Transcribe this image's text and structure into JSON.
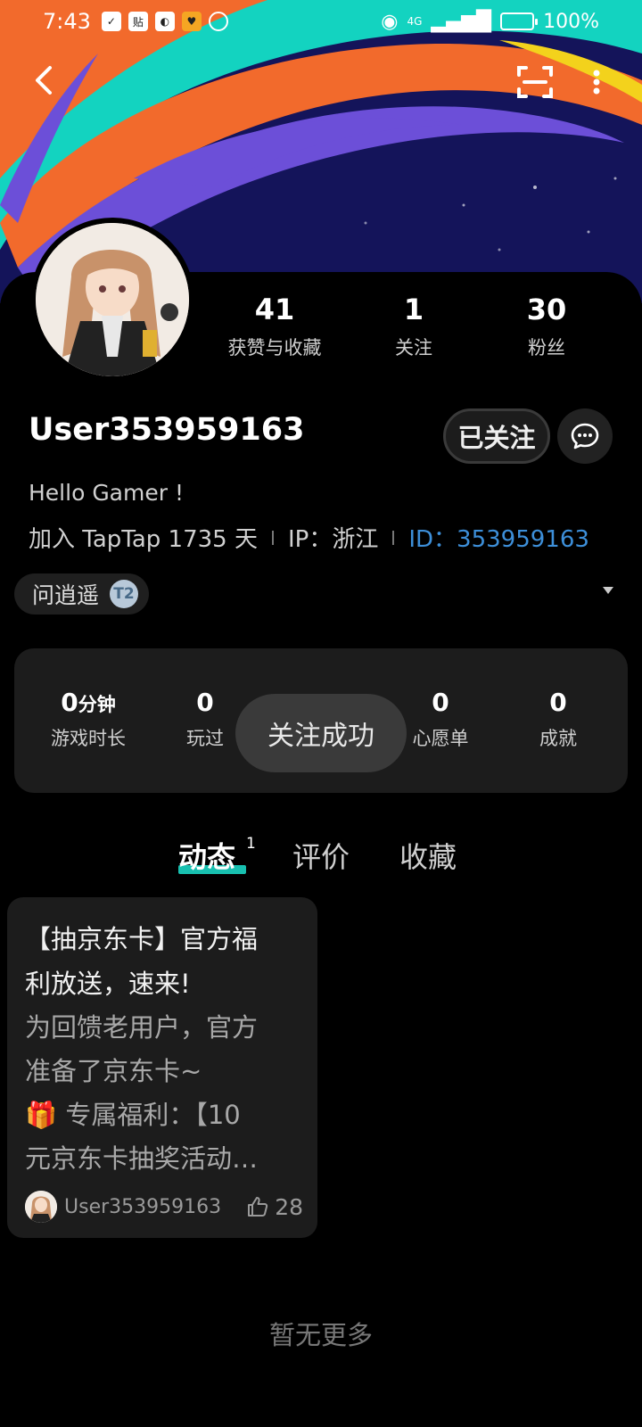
{
  "status_bar": {
    "time": "7:43",
    "battery": "100%",
    "network": "4G",
    "icons": [
      "shield-icon",
      "tieba-icon",
      "app-icon",
      "shopping-icon",
      "hand-icon",
      "eye-icon",
      "signal-icon",
      "battery-icon"
    ]
  },
  "profile": {
    "stats": [
      {
        "value": "41",
        "label": "获赞与收藏"
      },
      {
        "value": "1",
        "label": "关注"
      },
      {
        "value": "30",
        "label": "粉丝"
      }
    ],
    "username": "User353959163",
    "follow_label": "已关注",
    "bio": "Hello Gamer !",
    "join": "加入 TapTap 1735 天",
    "ip": "IP：浙江",
    "id": "ID：353959163",
    "title_badge": "问逍遥",
    "title_badge_icon": "T2"
  },
  "game_stats": [
    {
      "value": "0",
      "unit": "分钟",
      "label": "游戏时长"
    },
    {
      "value": "0",
      "label": "玩过"
    },
    {
      "value": "0",
      "label": "心愿单"
    },
    {
      "value": "0",
      "label": "成就"
    }
  ],
  "toast": "关注成功",
  "tabs": [
    {
      "label": "动态",
      "badge": "1",
      "active": true
    },
    {
      "label": "评价"
    },
    {
      "label": "收藏"
    }
  ],
  "post": {
    "title_line1": "【抽京东卡】官方福",
    "title_line2": "利放送，速来!",
    "body_line1": "为回馈老用户，官方",
    "body_line2": "准备了京东卡~",
    "body_line3": "🎁 专属福利：【10",
    "body_line4": "元京东卡抽奖活动…",
    "author": "User353959163",
    "likes": "28"
  },
  "no_more": "暂无更多",
  "colors": {
    "accent_teal": "#18c0b0",
    "id_blue": "#3d8fd9",
    "banner_navy": "#14145a",
    "banner_orange": "#f26a2c",
    "banner_purple": "#6c4fd8",
    "banner_cyan": "#13d3c0"
  }
}
